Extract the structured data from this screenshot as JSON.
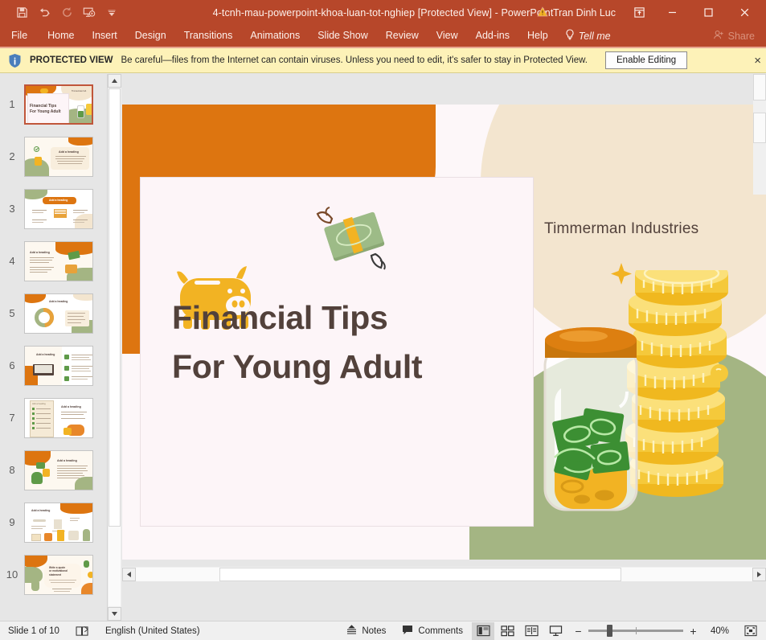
{
  "titlebar": {
    "document_title": "4-tcnh-mau-powerpoint-khoa-luan-tot-nghiep [Protected View]  -  PowerPoint",
    "user_name": "Tran Dinh Luc",
    "quick_access": [
      {
        "name": "save-icon",
        "label": "Save"
      },
      {
        "name": "undo-icon",
        "label": "Undo"
      },
      {
        "name": "redo-icon",
        "label": "Redo"
      },
      {
        "name": "start-slideshow-icon",
        "label": "Start From Beginning"
      },
      {
        "name": "customize-qat-icon",
        "label": "Customize Quick Access Toolbar"
      }
    ],
    "window_controls": {
      "ribbon_display": "Ribbon Display Options",
      "minimize": "Minimize",
      "maximize": "Restore Down",
      "close": "Close"
    }
  },
  "ribbon": {
    "tabs": [
      {
        "label": "File"
      },
      {
        "label": "Home"
      },
      {
        "label": "Insert"
      },
      {
        "label": "Design"
      },
      {
        "label": "Transitions"
      },
      {
        "label": "Animations"
      },
      {
        "label": "Slide Show"
      },
      {
        "label": "Review"
      },
      {
        "label": "View"
      },
      {
        "label": "Add-ins"
      },
      {
        "label": "Help"
      }
    ],
    "tell_me": "Tell me",
    "share": "Share"
  },
  "protected_view": {
    "label": "PROTECTED VIEW",
    "message": "Be careful—files from the Internet can contain viruses. Unless you need to edit, it's safer to stay in Protected View.",
    "enable_button": "Enable Editing",
    "close": "×"
  },
  "thumbnails": [
    {
      "number": "1",
      "selected": true
    },
    {
      "number": "2",
      "selected": false
    },
    {
      "number": "3",
      "selected": false
    },
    {
      "number": "4",
      "selected": false
    },
    {
      "number": "5",
      "selected": false
    },
    {
      "number": "6",
      "selected": false
    },
    {
      "number": "7",
      "selected": false
    },
    {
      "number": "8",
      "selected": false
    },
    {
      "number": "9",
      "selected": false
    },
    {
      "number": "10",
      "selected": false
    }
  ],
  "slide": {
    "title_line1": "Financial Tips",
    "title_line2": "For Young Adult",
    "company": "Timmerman Industries",
    "colors": {
      "orange": "#dd7510",
      "cream": "#f3e5cf",
      "green": "#a4b583",
      "title_text": "#52413b",
      "panel": "#fdf5f8",
      "piggy_yellow": "#f2b323",
      "money_green": "#8ba875",
      "coin_gold": "#f5c93b"
    }
  },
  "statusbar": {
    "slide_counter": "Slide 1 of 10",
    "language": "English (United States)",
    "notes": "Notes",
    "comments": "Comments",
    "views": [
      {
        "name": "normal-view",
        "label": "Normal",
        "active": true
      },
      {
        "name": "slide-sorter-view",
        "label": "Slide Sorter",
        "active": false
      },
      {
        "name": "reading-view",
        "label": "Reading View",
        "active": false
      },
      {
        "name": "slide-show-view",
        "label": "Slide Show",
        "active": false
      }
    ],
    "zoom_percent": "40%",
    "zoom_out": "−",
    "zoom_in": "+",
    "fit_label": "Fit slide to current window"
  }
}
